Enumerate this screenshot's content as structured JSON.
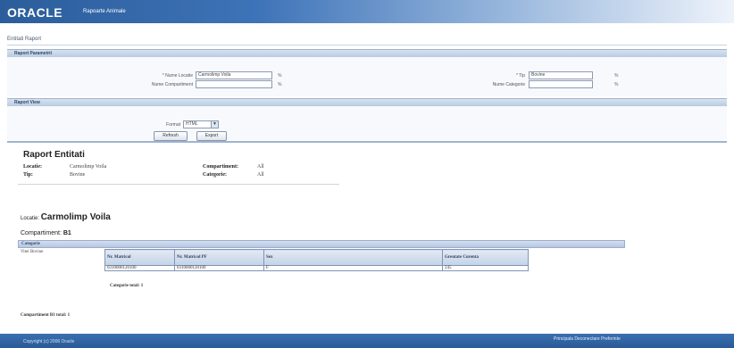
{
  "header": {
    "logo": "ORACLE",
    "app_title": "Rapoarte Animale"
  },
  "breadcrumb": "Entitati Raport",
  "params": {
    "section_title": "Raport Parametrii",
    "nume_locatie_label": "* Nume Locatie",
    "nume_locatie_value": "Carmolimp Voila",
    "nume_compartiment_label": "Nume Compartiment",
    "nume_compartiment_value": "",
    "tip_label": "* Tip",
    "tip_value": "Bovine",
    "nume_categorie_label": "Nume Categorie",
    "nume_categorie_value": "",
    "pct": "%"
  },
  "view": {
    "section_title": "Raport View",
    "format_label": "Format",
    "format_value": "HTML",
    "refresh_label": "Refresh",
    "export_label": "Export"
  },
  "report": {
    "title": "Raport Entitati",
    "summary": {
      "locatie_label": "Locatie:",
      "locatie_value": "Carmolimp Voila",
      "compartiment_label": "Compartiment:",
      "compartiment_value": "All",
      "tip_label": "Tip:",
      "tip_value": "Bovine",
      "categorie_label": "Categorie:",
      "categorie_value": "All"
    },
    "locatie_label": "Locatie:",
    "locatie_value": "Carmolimp Voila",
    "compartiment_label": "Compartiment:",
    "compartiment_value": "B1",
    "categorie_header": "Categorie",
    "categorie_value": "Vitei Bovine",
    "table": {
      "columns": [
        "Nr. Matricol",
        "Nr. Matricol PF",
        "Sex",
        "Greutate Curenta"
      ],
      "rows": [
        [
          "0310000120100",
          "0310000120100",
          "F",
          "245"
        ]
      ]
    },
    "categorie_total": "Categorie total: 1",
    "compartiment_total": "Compartiment B1 total: 1"
  },
  "footer": {
    "left_text": "Copyright (c) 2006 Oracle",
    "links": "Principala  Deconectare  Preferinte"
  }
}
